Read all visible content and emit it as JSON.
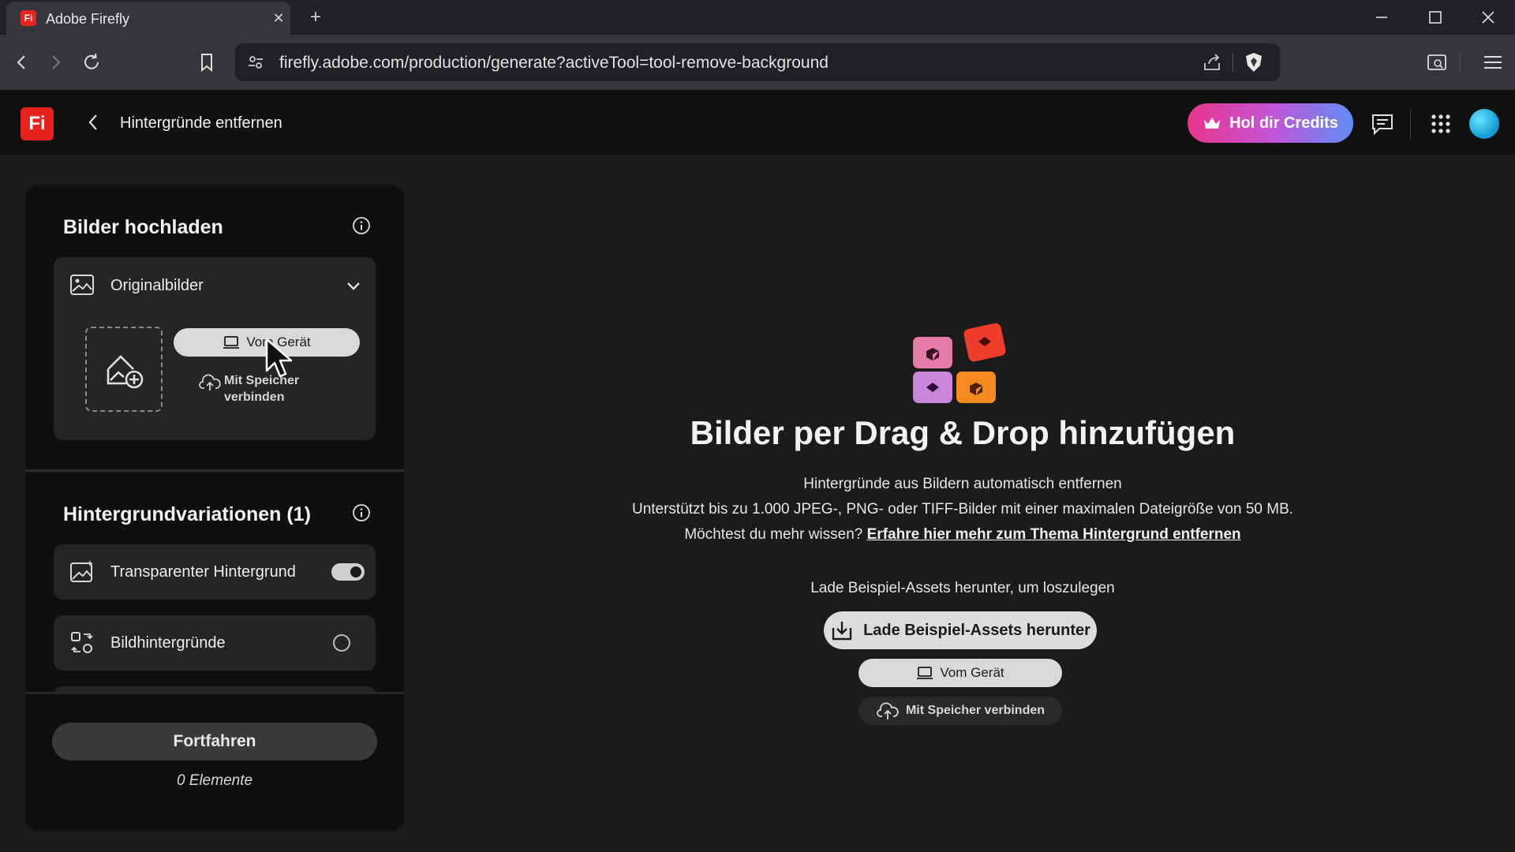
{
  "browser": {
    "tab_title": "Adobe Firefly",
    "tab_favicon": "Fi",
    "url": "firefly.adobe.com/production/generate?activeTool=tool-remove-background"
  },
  "header": {
    "logo": "Fi",
    "title": "Hintergründe entfernen",
    "credits_button": "Hol dir Credits"
  },
  "panel": {
    "upload_heading": "Bilder hochladen",
    "original_card": {
      "label": "Originalbilder",
      "from_device_button": "Vom Gerät",
      "connect_storage_line1": "Mit Speicher",
      "connect_storage_line2": "verbinden"
    },
    "variations_heading": "Hintergrundvariationen (1)",
    "variations": [
      {
        "label": "Transparenter Hintergrund",
        "enabled": true
      },
      {
        "label": "Bildhintergründe",
        "enabled": false
      }
    ],
    "continue_button": "Fortfahren",
    "elements_count": "0 Elemente"
  },
  "main": {
    "title": "Bilder per Drag & Drop hinzufügen",
    "line1": "Hintergründe aus Bildern automatisch entfernen",
    "line2": "Unterstützt bis zu 1.000 JPEG-, PNG- oder TIFF-Bilder mit einer maximalen Dateigröße von 50 MB.",
    "line3_prefix": "Möchtest du mehr wissen?",
    "line3_link": "Erfahre hier mehr zum Thema Hintergrund entfernen",
    "samples_text": "Lade Beispiel-Assets herunter, um loszulegen",
    "download_button": "Lade Beispiel-Assets herunter",
    "device_button": "Vom Gerät",
    "storage_button": "Mit Speicher verbinden"
  },
  "colors": {
    "accent_red": "#e8231f",
    "credits_gradient_start": "#e9358b",
    "credits_gradient_end": "#5f8cf5"
  }
}
